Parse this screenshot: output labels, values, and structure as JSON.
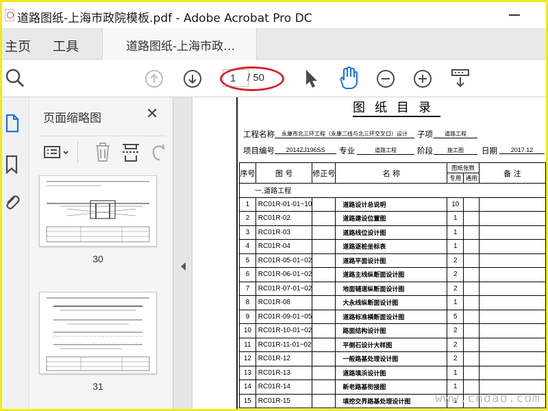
{
  "window": {
    "title": "道路图纸-上海市政院模板.pdf - Adobe Acrobat Pro DC"
  },
  "tabs": {
    "home": "主页",
    "tools": "工具",
    "document": "道路图纸-上海市政…"
  },
  "toolbar": {
    "current_page": "1",
    "total_pages": "/ 50"
  },
  "left_panel": {
    "title": "页面缩略图",
    "thumbnails": [
      {
        "page_label": "30"
      },
      {
        "page_label": "31"
      }
    ]
  },
  "document": {
    "title": "图纸目录",
    "info": {
      "project_name_label": "工程名称",
      "project_name_value": "永康市北三环工程（永康二线与北三环交叉口）设计",
      "subitem_label": "子项",
      "subitem_value": "道路工程",
      "project_no_label": "项目编号",
      "project_no_value": "2014ZJ196SS",
      "specialty_label": "专业",
      "specialty_value": "道路工程",
      "stage_label": "阶段",
      "stage_value": "施工图",
      "date_label": "日期",
      "date_value": "2017.12"
    },
    "table": {
      "headers": {
        "no": "序号",
        "drawing_no": "图 号",
        "revision": "修正号",
        "name": "名 称",
        "sheet_count": "图纸张数",
        "dedicated": "专用",
        "general": "通用",
        "remarks": "备 注"
      },
      "section": "一.道路工程",
      "rows": [
        {
          "no": "1",
          "code": "RC01R-01-01~10",
          "name": "道路设计总说明",
          "count": "10"
        },
        {
          "no": "2",
          "code": "RC01R-02",
          "name": "道路建设位置图",
          "count": "1"
        },
        {
          "no": "3",
          "code": "RC01R-03",
          "name": "道路线位设计图",
          "count": "1"
        },
        {
          "no": "4",
          "code": "RC01R-04",
          "name": "道路逐桩坐标表",
          "count": "1"
        },
        {
          "no": "5",
          "code": "RC01R-05-01~02",
          "name": "道路平面设计图",
          "count": "2"
        },
        {
          "no": "6",
          "code": "RC01R-06-01~02",
          "name": "道路主线纵断面设计图",
          "count": "2"
        },
        {
          "no": "7",
          "code": "RC01R-07-01~02",
          "name": "地面辅道纵断面设计图",
          "count": "2"
        },
        {
          "no": "8",
          "code": "RC01R-08",
          "name": "大永线纵断面设计图",
          "count": "1"
        },
        {
          "no": "9",
          "code": "RC01R-09-01~05",
          "name": "道路标准横断面设计图",
          "count": "5"
        },
        {
          "no": "10",
          "code": "RC01R-10-01~02",
          "name": "路面结构设计图",
          "count": "2"
        },
        {
          "no": "11",
          "code": "RC01R-11-01~02",
          "name": "平侧石设计大样图",
          "count": "2"
        },
        {
          "no": "12",
          "code": "RC01R-12",
          "name": "一般路基处理设计图",
          "count": "2"
        },
        {
          "no": "13",
          "code": "RC01R-13",
          "name": "道路填浜设计图",
          "count": "1"
        },
        {
          "no": "14",
          "code": "RC01R-14",
          "name": "新老路基衔接图",
          "count": "1"
        },
        {
          "no": "15",
          "code": "RC01R-15",
          "name": "填挖交界路基处理设计图",
          "count": "1"
        }
      ]
    }
  },
  "watermark": "www.cndao.com",
  "colors": {
    "accent_blue": "#1473e6",
    "highlight_red": "#d8232a",
    "frame_yellow": "#f0e81a"
  }
}
